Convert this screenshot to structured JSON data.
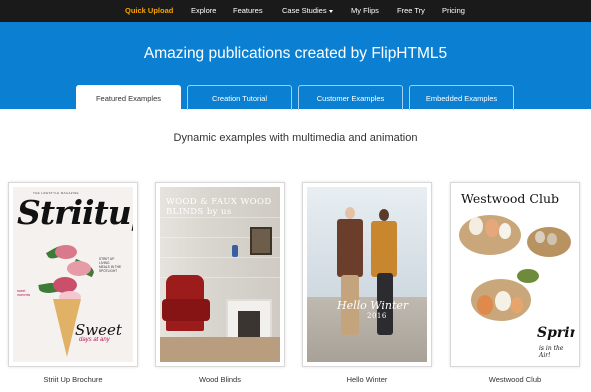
{
  "nav": {
    "items": [
      {
        "label": "Quick Upload",
        "active": true
      },
      {
        "label": "Explore"
      },
      {
        "label": "Features"
      },
      {
        "label": "Case Studies"
      },
      {
        "label": "My Flips"
      },
      {
        "label": "Free Try"
      },
      {
        "label": "Pricing"
      }
    ]
  },
  "hero": {
    "title": "Amazing publications created by FlipHTML5"
  },
  "tabs": [
    {
      "label": "Featured Examples",
      "active": true
    },
    {
      "label": "Creation Tutorial"
    },
    {
      "label": "Customer Examples"
    },
    {
      "label": "Embedded Examples"
    }
  ],
  "subtitle": "Dynamic examples with multimedia and animation",
  "cards": [
    {
      "caption": "Striit Up Brochure",
      "cover_title": "Striitup",
      "cover_tagline": "THE LIFESTYLE MAGAZINE",
      "cover_big": "Sweet",
      "cover_small": "days at any"
    },
    {
      "caption": "Wood Blinds",
      "cover_title_line1": "WOOD & FAUX WOOD",
      "cover_title_line2": "BLINDS by us"
    },
    {
      "caption": "Hello Winter",
      "cover_title": "Hello Winter",
      "cover_year": "2016"
    },
    {
      "caption": "Westwood Club",
      "cover_title": "Westwood Club",
      "cover_big": "Spring",
      "cover_small": "is in the Air!"
    }
  ],
  "colors": {
    "nav_bg": "#1a1a1a",
    "nav_active": "#f7a400",
    "hero_bg": "#0b80d3"
  },
  "icons": {
    "case_studies_dropdown": "caret-down-icon"
  }
}
